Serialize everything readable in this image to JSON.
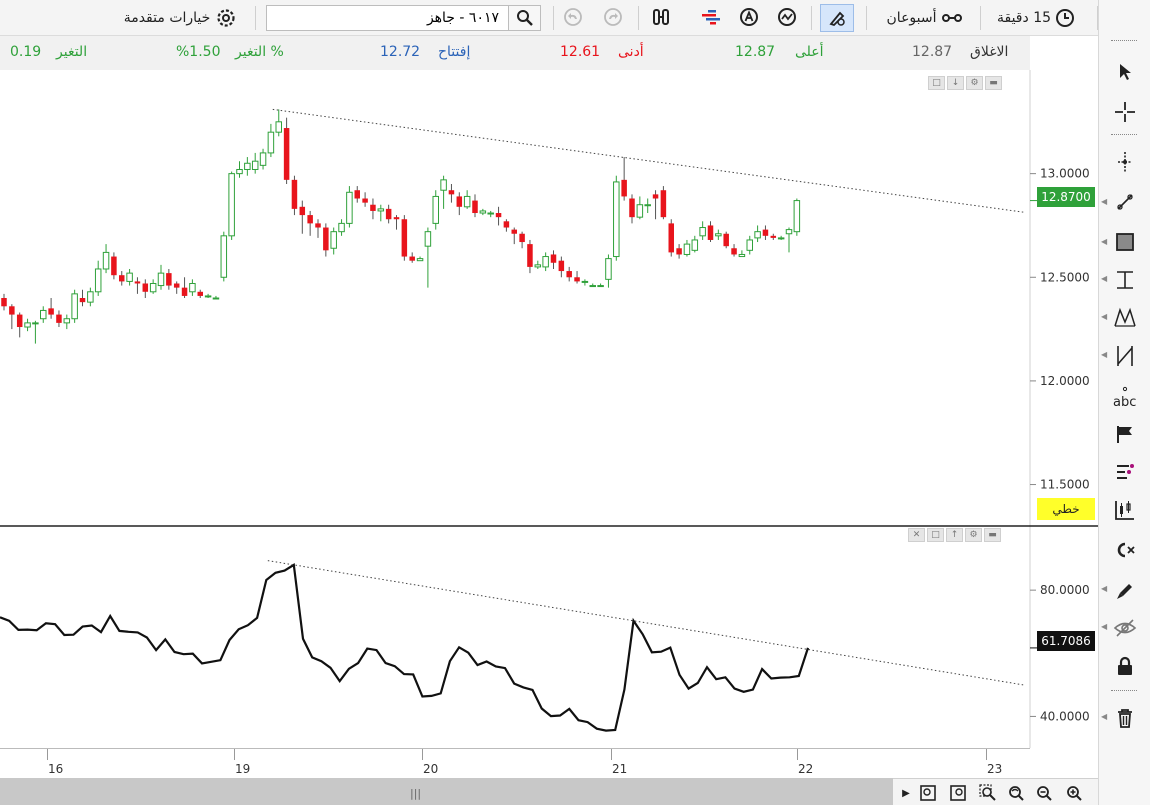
{
  "toolbar": {
    "interval_label": "15 دقيقة",
    "range_label": "أسبوعان",
    "symbol_value": "٦٠١٧ - جاهز",
    "advanced_options_label": "خيارات متقدمة"
  },
  "quote": {
    "close_label": "الاغلاق",
    "close_value": "12.87",
    "high_label": "أعلى",
    "high_value": "12.87",
    "low_label": "أدنى",
    "low_value": "12.61",
    "open_label": "إفتتاح",
    "open_value": "12.72",
    "change_pct_label": "التغير %",
    "change_pct_value": "%1.50",
    "change_label": "التغير",
    "change_value": "0.19"
  },
  "colors": {
    "up": "#2fa13a",
    "down": "#e8141c",
    "osc": "#111111",
    "trend": "#444444",
    "accent": "#5b8fd6"
  },
  "icons": [
    "pencil-icon",
    "clock-icon",
    "range-icon",
    "search-icon",
    "undo-icon",
    "redo-icon",
    "compare-icon",
    "bars-icon",
    "a-circle-icon",
    "wave-icon",
    "draw-cursor-icon",
    "gear-icon"
  ],
  "scale_mode": "خطي",
  "chart_data": [
    {
      "type": "candlestick",
      "ylim": [
        11.3,
        13.5
      ],
      "yticks": [
        "13.0000",
        "12.5000",
        "12.0000",
        "11.5000"
      ],
      "ytick_values": [
        13.0,
        12.5,
        12.0,
        11.5
      ],
      "last_value": "12.8700",
      "x_ticks": [
        "16",
        "19",
        "20",
        "21",
        "22",
        "23"
      ],
      "candles": [
        [
          12.4,
          12.36,
          12.42,
          12.34
        ],
        [
          12.36,
          12.32,
          12.37,
          12.25
        ],
        [
          12.32,
          12.26,
          12.33,
          12.21
        ],
        [
          12.26,
          12.28,
          12.3,
          12.24
        ],
        [
          12.28,
          12.28,
          12.29,
          12.18
        ],
        [
          12.3,
          12.34,
          12.36,
          12.28
        ],
        [
          12.35,
          12.32,
          12.4,
          12.3
        ],
        [
          12.32,
          12.28,
          12.34,
          12.26
        ],
        [
          12.28,
          12.3,
          12.32,
          12.25
        ],
        [
          12.3,
          12.42,
          12.44,
          12.28
        ],
        [
          12.4,
          12.38,
          12.44,
          12.36
        ],
        [
          12.38,
          12.43,
          12.45,
          12.36
        ],
        [
          12.43,
          12.54,
          12.58,
          12.41
        ],
        [
          12.54,
          12.62,
          12.66,
          12.52
        ],
        [
          12.6,
          12.51,
          12.62,
          12.49
        ],
        [
          12.51,
          12.48,
          12.53,
          12.46
        ],
        [
          12.48,
          12.52,
          12.54,
          12.46
        ],
        [
          12.48,
          12.47,
          12.5,
          12.42
        ],
        [
          12.47,
          12.43,
          12.49,
          12.4
        ],
        [
          12.43,
          12.47,
          12.49,
          12.42
        ],
        [
          12.46,
          12.52,
          12.56,
          12.44
        ],
        [
          12.52,
          12.46,
          12.54,
          12.44
        ],
        [
          12.47,
          12.45,
          12.48,
          12.42
        ],
        [
          12.45,
          12.41,
          12.5,
          12.4
        ],
        [
          12.43,
          12.47,
          12.49,
          12.41
        ],
        [
          12.43,
          12.41,
          12.44,
          12.4
        ],
        [
          12.41,
          12.41,
          12.42,
          12.4
        ],
        [
          12.4,
          12.4,
          12.41,
          12.4
        ],
        [
          12.5,
          12.7,
          12.72,
          12.48
        ],
        [
          12.7,
          13.0,
          13.01,
          12.68
        ],
        [
          13.0,
          13.02,
          13.06,
          12.98
        ],
        [
          13.02,
          13.05,
          13.08,
          12.99
        ],
        [
          13.02,
          13.06,
          13.1,
          13.0
        ],
        [
          13.04,
          13.1,
          13.12,
          13.02
        ],
        [
          13.1,
          13.2,
          13.24,
          13.08
        ],
        [
          13.2,
          13.25,
          13.31,
          13.18
        ],
        [
          13.22,
          12.97,
          13.27,
          12.95
        ],
        [
          12.97,
          12.83,
          12.99,
          12.8
        ],
        [
          12.84,
          12.8,
          12.87,
          12.71
        ],
        [
          12.8,
          12.76,
          12.82,
          12.7
        ],
        [
          12.76,
          12.74,
          12.78,
          12.69
        ],
        [
          12.74,
          12.63,
          12.76,
          12.6
        ],
        [
          12.64,
          12.72,
          12.74,
          12.61
        ],
        [
          12.72,
          12.76,
          12.78,
          12.7
        ],
        [
          12.76,
          12.91,
          12.94,
          12.74
        ],
        [
          12.92,
          12.88,
          12.94,
          12.86
        ],
        [
          12.88,
          12.86,
          12.91,
          12.84
        ],
        [
          12.85,
          12.82,
          12.88,
          12.78
        ],
        [
          12.82,
          12.83,
          12.85,
          12.77
        ],
        [
          12.83,
          12.78,
          12.85,
          12.76
        ],
        [
          12.79,
          12.78,
          12.8,
          12.73
        ],
        [
          12.78,
          12.6,
          12.8,
          12.58
        ],
        [
          12.6,
          12.58,
          12.62,
          12.57
        ],
        [
          12.58,
          12.59,
          12.6,
          12.58
        ],
        [
          12.65,
          12.72,
          12.74,
          12.45
        ],
        [
          12.76,
          12.89,
          12.92,
          12.73
        ],
        [
          12.92,
          12.97,
          12.99,
          12.83
        ],
        [
          12.92,
          12.9,
          12.95,
          12.86
        ],
        [
          12.89,
          12.84,
          12.91,
          12.8
        ],
        [
          12.84,
          12.89,
          12.92,
          12.83
        ],
        [
          12.87,
          12.81,
          12.9,
          12.79
        ],
        [
          12.81,
          12.82,
          12.83,
          12.8
        ],
        [
          12.81,
          12.81,
          12.82,
          12.79
        ],
        [
          12.81,
          12.79,
          12.84,
          12.75
        ],
        [
          12.77,
          12.74,
          12.78,
          12.72
        ],
        [
          12.73,
          12.71,
          12.74,
          12.66
        ],
        [
          12.71,
          12.67,
          12.72,
          12.64
        ],
        [
          12.66,
          12.55,
          12.68,
          12.52
        ],
        [
          12.55,
          12.56,
          12.58,
          12.54
        ],
        [
          12.55,
          12.6,
          12.62,
          12.53
        ],
        [
          12.61,
          12.57,
          12.63,
          12.54
        ],
        [
          12.58,
          12.53,
          12.6,
          12.5
        ],
        [
          12.53,
          12.5,
          12.55,
          12.48
        ],
        [
          12.5,
          12.48,
          12.53,
          12.47
        ],
        [
          12.48,
          12.48,
          12.49,
          12.46
        ],
        [
          12.46,
          12.46,
          12.47,
          12.46
        ],
        [
          12.46,
          12.46,
          12.47,
          12.46
        ],
        [
          12.49,
          12.59,
          12.61,
          12.45
        ],
        [
          12.6,
          12.96,
          12.99,
          12.58
        ],
        [
          12.97,
          12.89,
          13.08,
          12.87
        ],
        [
          12.88,
          12.79,
          12.9,
          12.76
        ],
        [
          12.79,
          12.85,
          12.89,
          12.78
        ],
        [
          12.85,
          12.85,
          12.88,
          12.81
        ],
        [
          12.9,
          12.88,
          12.92,
          12.78
        ],
        [
          12.92,
          12.79,
          12.94,
          12.78
        ],
        [
          12.76,
          12.62,
          12.78,
          12.6
        ],
        [
          12.64,
          12.61,
          12.66,
          12.59
        ],
        [
          12.61,
          12.66,
          12.68,
          12.6
        ],
        [
          12.63,
          12.68,
          12.7,
          12.62
        ],
        [
          12.7,
          12.74,
          12.77,
          12.68
        ],
        [
          12.75,
          12.68,
          12.77,
          12.67
        ],
        [
          12.7,
          12.71,
          12.73,
          12.68
        ],
        [
          12.71,
          12.65,
          12.72,
          12.64
        ],
        [
          12.64,
          12.61,
          12.66,
          12.6
        ],
        [
          12.6,
          12.61,
          12.63,
          12.6
        ],
        [
          12.63,
          12.68,
          12.7,
          12.61
        ],
        [
          12.69,
          12.72,
          12.75,
          12.67
        ],
        [
          12.73,
          12.7,
          12.75,
          12.68
        ],
        [
          12.7,
          12.69,
          12.71,
          12.68
        ],
        [
          12.69,
          12.69,
          12.7,
          12.68
        ],
        [
          12.71,
          12.73,
          12.74,
          12.62
        ],
        [
          12.72,
          12.87,
          12.88,
          12.7
        ]
      ]
    },
    {
      "type": "line",
      "ylim": [
        30,
        100
      ],
      "yticks": [
        "80.0000",
        "40.0000"
      ],
      "ytick_values": [
        80,
        40
      ],
      "last_value": "61.7086",
      "values": [
        71.4,
        70.3,
        67.4,
        67.5,
        67.3,
        69.5,
        69.2,
        65.8,
        65.9,
        68.5,
        68.8,
        66.7,
        71.8,
        67.1,
        66.8,
        66.6,
        65.0,
        61.0,
        64.4,
        60.4,
        59.7,
        59.9,
        56.8,
        57.3,
        57.8,
        64.2,
        67.6,
        68.9,
        71.2,
        83.2,
        85.5,
        86.2,
        88.0,
        64.6,
        58.7,
        57.5,
        55.4,
        51.2,
        55.1,
        56.9,
        61.5,
        61.0,
        56.9,
        55.9,
        53.4,
        53.3,
        46.3,
        46.5,
        47.3,
        57.5,
        61.9,
        60.2,
        56.3,
        57.4,
        55.8,
        55.3,
        50.4,
        49.2,
        48.4,
        42.5,
        40.1,
        40.3,
        42.4,
        38.8,
        38.2,
        36.1,
        35.5,
        35.7,
        48.5,
        70.3,
        66.0,
        60.3,
        60.5,
        61.8,
        53.2,
        48.8,
        50.6,
        55.6,
        51.8,
        52.4,
        48.8,
        47.8,
        48.5,
        55.0,
        52.0,
        52.3,
        52.4,
        52.8,
        61.7
      ]
    }
  ]
}
